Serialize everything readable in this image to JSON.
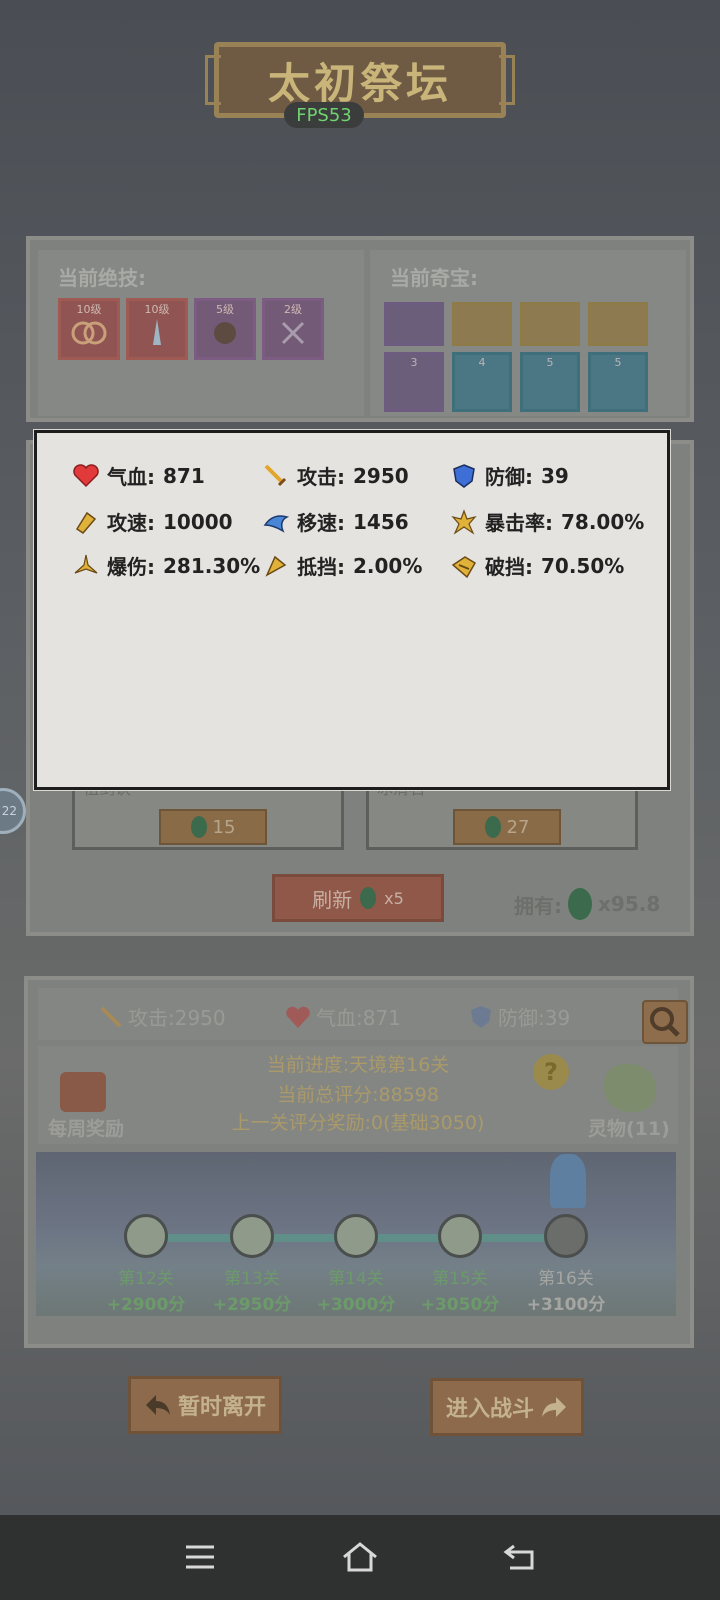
{
  "title": "太初祭坛",
  "fps": "FPS53",
  "side_badge": "22",
  "skills_panel": {
    "label": "当前绝技:",
    "skills": [
      {
        "level": "10级",
        "color": "red"
      },
      {
        "level": "10级",
        "color": "red"
      },
      {
        "level": "5级",
        "color": "purple"
      },
      {
        "level": "2级",
        "color": "purple"
      }
    ]
  },
  "treasure_panel": {
    "label": "当前奇宝:",
    "row2_counts": [
      "3",
      "4",
      "5",
      "5"
    ]
  },
  "cards": [
    {
      "label": "祖剑诀",
      "cost": "15"
    },
    {
      "label": "冰清石",
      "cost": "27"
    }
  ],
  "refresh": {
    "label": "刷新",
    "cost": "x5"
  },
  "own": {
    "label": "拥有:",
    "amount": "x95.8"
  },
  "popup": {
    "attributes": [
      {
        "icon": "heart-icon",
        "label": "气血:",
        "value": "871"
      },
      {
        "icon": "sword-icon",
        "label": "攻击:",
        "value": "2950"
      },
      {
        "icon": "shield-icon",
        "label": "防御:",
        "value": "39"
      },
      {
        "icon": "attack-speed-icon",
        "label": "攻速:",
        "value": "10000"
      },
      {
        "icon": "move-speed-icon",
        "label": "移速:",
        "value": "1456"
      },
      {
        "icon": "crit-rate-icon",
        "label": "暴击率:",
        "value": "78.00%"
      },
      {
        "icon": "crit-damage-icon",
        "label": "爆伤:",
        "value": "281.30%"
      },
      {
        "icon": "block-icon",
        "label": "抵挡:",
        "value": "2.00%"
      },
      {
        "icon": "break-block-icon",
        "label": "破挡:",
        "value": "70.50%"
      }
    ]
  },
  "stats_row": {
    "attack": "攻击:2950",
    "hp": "气血:871",
    "defense": "防御:39"
  },
  "progress": {
    "current_progress": "当前进度:天境第16关",
    "total_score": "当前总评分:88598",
    "last_reward": "上一关评分奖励:0(基础3050)",
    "weekly_reward": "每周奖励",
    "spirit": "灵物(11)",
    "help": "?"
  },
  "stages": [
    {
      "name": "第12关",
      "score": "+2900分",
      "cleared": true
    },
    {
      "name": "第13关",
      "score": "+2950分",
      "cleared": true
    },
    {
      "name": "第14关",
      "score": "+3000分",
      "cleared": true
    },
    {
      "name": "第15关",
      "score": "+3050分",
      "cleared": true
    },
    {
      "name": "第16关",
      "score": "+3100分",
      "cleared": false
    }
  ],
  "buttons": {
    "leave": "暂时离开",
    "fight": "进入战斗"
  },
  "colors": {
    "popup_bg": "#e4e3df",
    "cleared_stage": "#6d9a6a",
    "fps_green": "#6fd36f"
  }
}
